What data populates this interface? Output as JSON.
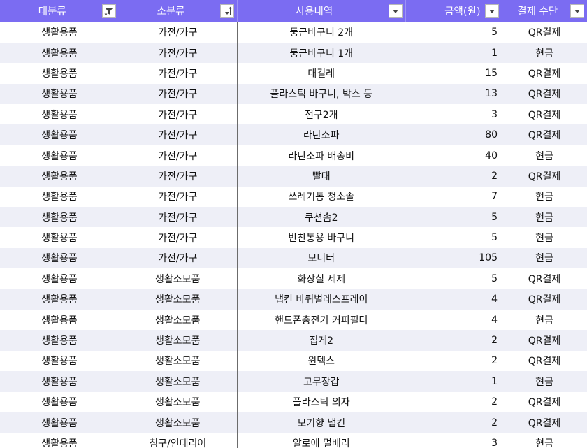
{
  "headers": {
    "major": "대분류",
    "minor": "소분류",
    "detail": "사용내역",
    "amount": "금액(원)",
    "payment": "결제 수단"
  },
  "header_buttons": {
    "major": "filter-applied-icon",
    "minor": "sort-descending-icon",
    "detail": "dropdown-arrow-icon",
    "amount": "dropdown-arrow-icon",
    "payment": "dropdown-arrow-icon"
  },
  "colors": {
    "header_bg": "#7b6cf2",
    "header_text": "#ffffff",
    "band_row": "#eeeff7"
  },
  "rows": [
    [
      "생활용품",
      "가전/가구",
      "둥근바구니 2개",
      "5",
      "QR결제"
    ],
    [
      "생활용품",
      "가전/가구",
      "둥근바구니 1개",
      "1",
      "현금"
    ],
    [
      "생활용품",
      "가전/가구",
      "대걸레",
      "15",
      "QR결제"
    ],
    [
      "생활용품",
      "가전/가구",
      "플라스틱 바구니, 박스 등",
      "13",
      "QR결제"
    ],
    [
      "생활용품",
      "가전/가구",
      "전구2개",
      "3",
      "QR결제"
    ],
    [
      "생활용품",
      "가전/가구",
      "라탄소파",
      "80",
      "QR결제"
    ],
    [
      "생활용품",
      "가전/가구",
      "라탄소파 배송비",
      "40",
      "현금"
    ],
    [
      "생활용품",
      "가전/가구",
      "빨대",
      "2",
      "QR결제"
    ],
    [
      "생활용품",
      "가전/가구",
      "쓰레기통 청소솔",
      "7",
      "현금"
    ],
    [
      "생활용품",
      "가전/가구",
      "쿠션솜2",
      "5",
      "현금"
    ],
    [
      "생활용품",
      "가전/가구",
      "반찬통용 바구니",
      "5",
      "현금"
    ],
    [
      "생활용품",
      "가전/가구",
      "모니터",
      "105",
      "현금"
    ],
    [
      "생활용품",
      "생활소모품",
      "화장실 세제",
      "5",
      "QR결제"
    ],
    [
      "생활용품",
      "생활소모품",
      "냅킨 바퀴벌레스프레이",
      "4",
      "QR결제"
    ],
    [
      "생활용품",
      "생활소모품",
      "핸드폰충전기 커피필터",
      "4",
      "현금"
    ],
    [
      "생활용품",
      "생활소모품",
      "집게2",
      "2",
      "QR결제"
    ],
    [
      "생활용품",
      "생활소모품",
      "윈덱스",
      "2",
      "QR결제"
    ],
    [
      "생활용품",
      "생활소모품",
      "고무장갑",
      "1",
      "현금"
    ],
    [
      "생활용품",
      "생활소모품",
      "플라스틱 의자",
      "2",
      "QR결제"
    ],
    [
      "생활용품",
      "생활소모품",
      "모기향 냅킨",
      "2",
      "QR결제"
    ],
    [
      "생활용품",
      "침구/인테리어",
      "알로에 멀베리",
      "3",
      "현금"
    ]
  ]
}
